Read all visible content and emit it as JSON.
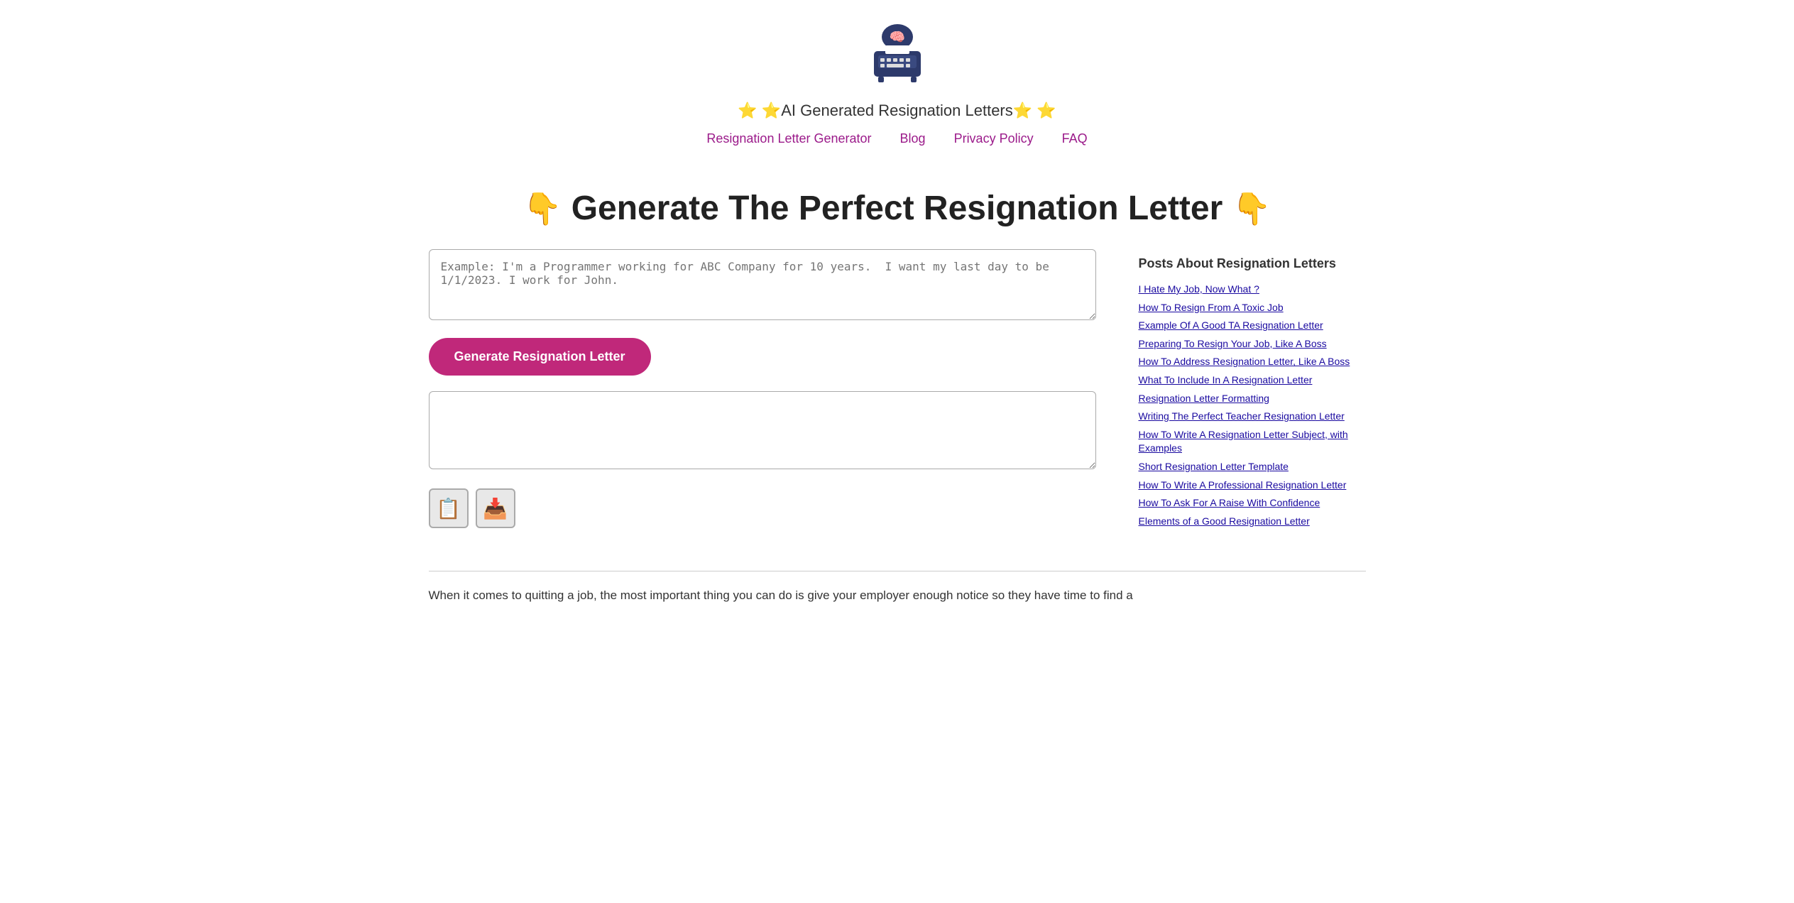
{
  "header": {
    "logo_emoji": "🖨️",
    "site_title_prefix": "⭐AI Generated Resignation Letters⭐",
    "nav_links": [
      {
        "label": "Resignation Letter Generator",
        "href": "#"
      },
      {
        "label": "Blog",
        "href": "#"
      },
      {
        "label": "Privacy Policy",
        "href": "#"
      },
      {
        "label": "FAQ",
        "href": "#"
      }
    ]
  },
  "hero": {
    "emoji_left": "👇",
    "title": "Generate The Perfect Resignation Letter",
    "emoji_right": "👇"
  },
  "form": {
    "input_placeholder": "Example: I'm a Programmer working for ABC Company for 10 years.  I want my last day to be 1/1/2023. I work for John.",
    "generate_button_label": "Generate Resignation Letter",
    "output_placeholder": ""
  },
  "action_buttons": [
    {
      "name": "copy-button",
      "icon": "📋",
      "label": "Copy"
    },
    {
      "name": "download-button",
      "icon": "📥",
      "label": "Download"
    }
  ],
  "sidebar": {
    "title": "Posts About Resignation Letters",
    "links": [
      {
        "label": "I Hate My Job, Now What ?",
        "href": "#"
      },
      {
        "label": "How To Resign From A Toxic Job",
        "href": "#"
      },
      {
        "label": "Example Of A Good TA Resignation Letter",
        "href": "#"
      },
      {
        "label": "Preparing To Resign Your Job, Like A Boss",
        "href": "#"
      },
      {
        "label": "How To Address Resignation Letter, Like A Boss",
        "href": "#"
      },
      {
        "label": "What To Include In A Resignation Letter",
        "href": "#"
      },
      {
        "label": "Resignation Letter Formatting",
        "href": "#"
      },
      {
        "label": "Writing The Perfect Teacher Resignation Letter",
        "href": "#"
      },
      {
        "label": "How To Write A Resignation Letter Subject, with Examples",
        "href": "#"
      },
      {
        "label": "Short Resignation Letter Template",
        "href": "#"
      },
      {
        "label": "How To Write A Professional Resignation Letter",
        "href": "#"
      },
      {
        "label": "How To Ask For A Raise With Confidence",
        "href": "#"
      },
      {
        "label": "Elements of a Good Resignation Letter",
        "href": "#"
      }
    ]
  },
  "bottom_text": "When it comes to quitting a job, the most important thing you can do is give your employer enough notice so they have time to find a"
}
